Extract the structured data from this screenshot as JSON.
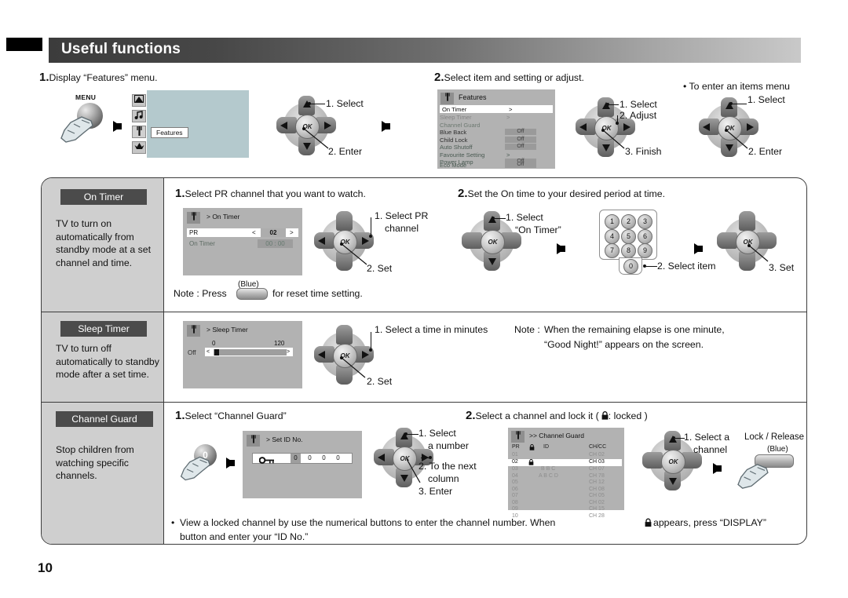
{
  "header": {
    "title": "Useful functions"
  },
  "top": {
    "step1": {
      "num": "1.",
      "text": "Display “Features” menu."
    },
    "menu_button_label": "MENU",
    "tv_menu_icons": [
      "picture-icon",
      "sound-icon",
      "features-icon",
      "install-icon"
    ],
    "features_tooltip": "Features",
    "dpad1": {
      "items": [
        "1. Select",
        "2. Enter"
      ]
    },
    "step2": {
      "num": "2.",
      "text": "Select item and setting or adjust."
    },
    "features_osd": {
      "title": "Features",
      "rows": [
        {
          "label": "On Timer",
          "value": ">",
          "selected": true
        },
        {
          "label": "Sleep Timer",
          "value": ">",
          "selected": false
        },
        {
          "label": "Channel Guard",
          "value": "",
          "selected": false
        },
        {
          "label": "Blue Back",
          "value": "Off",
          "selected": false
        },
        {
          "label": "Child Lock",
          "value": "Off",
          "selected": false
        },
        {
          "label": "Auto Shutoff",
          "value": "Off",
          "selected": false
        },
        {
          "label": "Favourite Setting",
          "value": ">",
          "selected": false
        },
        {
          "label": "Power Lamp",
          "value": "Off",
          "selected": false
        },
        {
          "label": "Eco Mode",
          "value": "Off",
          "selected": false
        }
      ]
    },
    "dpad2": {
      "items": [
        "1. Select",
        "2. Adjust",
        "3. Finish"
      ]
    },
    "enter_items_note": "• To enter an items menu",
    "dpad3": {
      "items": [
        "1. Select",
        "2. Enter"
      ]
    }
  },
  "rows": {
    "on_timer": {
      "badge": "On Timer",
      "description": "TV to turn on automatically from standby mode at a set channel and time.",
      "step1": {
        "num": "1.",
        "text": "Select PR channel that you want to watch."
      },
      "osd": {
        "title": "> On Timer",
        "pr_label": "PR",
        "pr_left": "<",
        "pr_value": "02",
        "pr_right": ">",
        "timer_label": "On Timer",
        "timer_value": "00 : 00"
      },
      "dpad_a": {
        "items": [
          "1. Select PR",
          "channel",
          "2. Set"
        ]
      },
      "note": {
        "prefix": "Note : Press",
        "button_label": "(Blue)",
        "suffix": "for reset time setting."
      },
      "step2": {
        "num": "2.",
        "text": "Set the On time to your desired period at time."
      },
      "dpad_b": {
        "items": [
          "1. Select",
          "“On Timer”"
        ]
      },
      "keypad": {
        "keys": [
          "1",
          "2",
          "3",
          "4",
          "5",
          "6",
          "7",
          "8",
          "9"
        ],
        "zero": "0",
        "caption": "2. Select item"
      },
      "dpad_c": {
        "items": [
          "3. Set"
        ]
      }
    },
    "sleep_timer": {
      "badge": "Sleep Timer",
      "description": "TV to turn off automatically to standby mode after a set time.",
      "osd": {
        "title": "> Sleep Timer",
        "off_label": "Off",
        "min": "0",
        "max": "120",
        "left_arrow": "<",
        "right_arrow": ">"
      },
      "dpad": {
        "items": [
          "1. Select a time in minutes",
          "2. Set"
        ]
      },
      "note": {
        "label": "Note :",
        "line1": "When the remaining elapse is one minute,",
        "line2": "“Good Night!” appears on the screen."
      }
    },
    "channel_guard": {
      "badge": "Channel Guard",
      "description": "Stop children from watching specific channels.",
      "step1": {
        "num": "1.",
        "text": "Select “Channel Guard”"
      },
      "zero_button": "0",
      "osd_id": {
        "title": "> Set ID No.",
        "key_icon": "key-icon",
        "digits": [
          "0",
          "0",
          "0",
          "0"
        ]
      },
      "dpad_a": {
        "items": [
          "1. Select",
          "a number",
          "2. To the next",
          "column",
          "3. Enter"
        ]
      },
      "step2": {
        "num": "2.",
        "prefix": "Select a channel and lock it (",
        "lock": "🔒",
        "suffix": ": locked )"
      },
      "osd_guard": {
        "title": ">> Channel Guard",
        "headers": [
          "PR",
          "🔒",
          "ID",
          "CH/CC"
        ],
        "rows": [
          {
            "pr": "01",
            "lock": "",
            "id": "",
            "ch": "CH  02",
            "selected": false
          },
          {
            "pr": "02",
            "lock": "🔒",
            "id": "",
            "ch": "CH  03",
            "selected": true
          },
          {
            "pr": "03",
            "lock": "",
            "id": "B B C",
            "ch": "CH  07",
            "selected": false
          },
          {
            "pr": "04",
            "lock": "",
            "id": "A B C D",
            "ch": "CH  78",
            "selected": false
          },
          {
            "pr": "05",
            "lock": "",
            "id": "",
            "ch": "CH  12",
            "selected": false
          },
          {
            "pr": "06",
            "lock": "",
            "id": "",
            "ch": "CH  08",
            "selected": false
          },
          {
            "pr": "07",
            "lock": "",
            "id": "",
            "ch": "CH  05",
            "selected": false
          },
          {
            "pr": "08",
            "lock": "",
            "id": "",
            "ch": "CH  02",
            "selected": false
          },
          {
            "pr": "09",
            "lock": "",
            "id": "",
            "ch": "CH  15",
            "selected": false
          },
          {
            "pr": "10",
            "lock": "",
            "id": "",
            "ch": "CH  28",
            "selected": false
          }
        ]
      },
      "dpad_b": {
        "items": [
          "1. Select a",
          "channel"
        ]
      },
      "lock_release": {
        "title": "Lock / Release",
        "color": "(Blue)"
      },
      "footnote": {
        "bullet": "•",
        "line1a": "View a locked channel by use the numerical buttons to enter the channel number. When",
        "lock": "🔒",
        "line1b": "appears, press “DISPLAY”",
        "line2": "button and enter your “ID No.”"
      }
    }
  },
  "page_number": "10"
}
